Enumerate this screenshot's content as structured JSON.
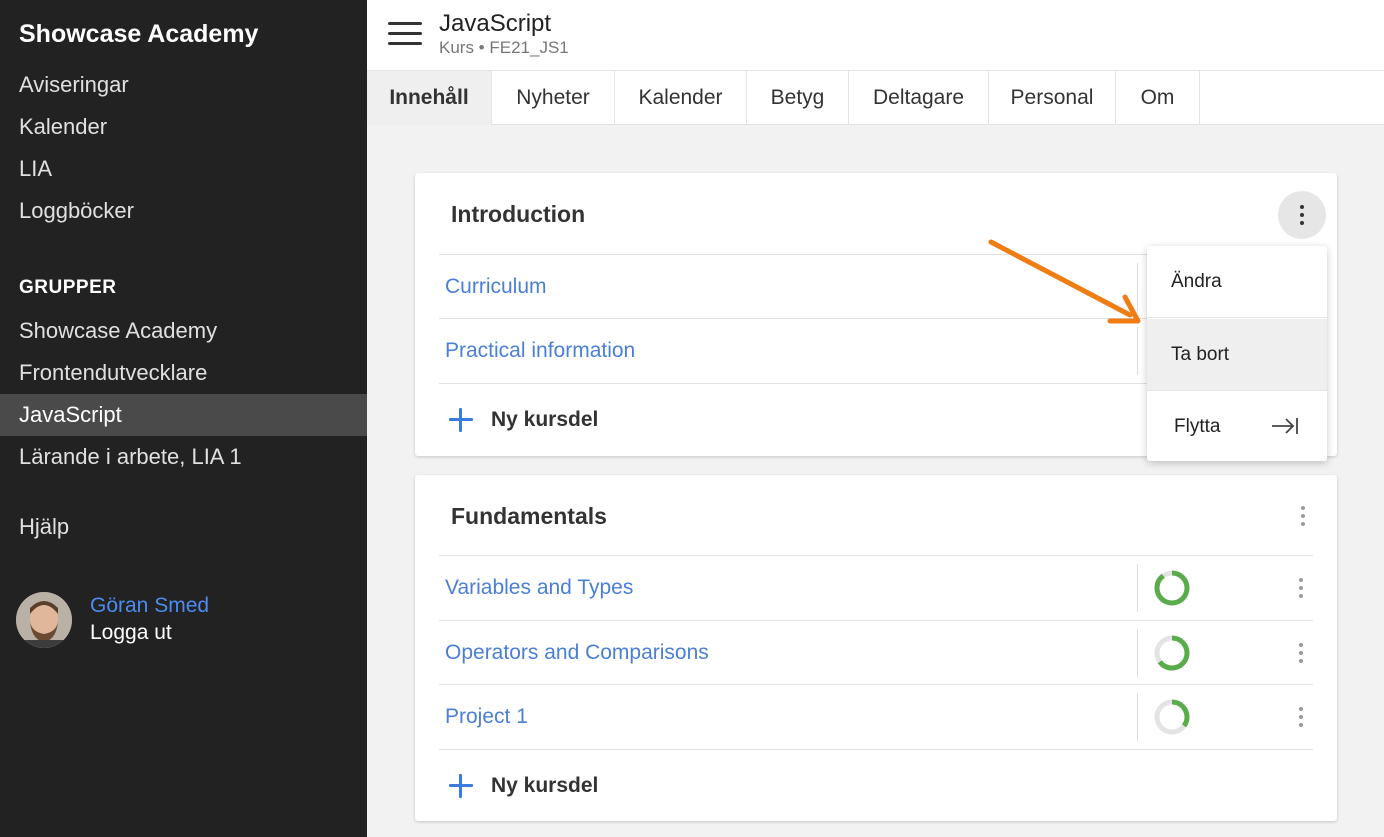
{
  "sidebar": {
    "brand": "Showcase Academy",
    "items": [
      {
        "label": "Aviseringar"
      },
      {
        "label": "Kalender"
      },
      {
        "label": "LIA"
      },
      {
        "label": "Loggböcker"
      }
    ],
    "groups_label": "GRUPPER",
    "groups": [
      {
        "label": "Showcase Academy"
      },
      {
        "label": "Frontendutvecklare"
      },
      {
        "label": "JavaScript",
        "active": true
      },
      {
        "label": "Lärande i arbete, LIA 1"
      }
    ],
    "help": "Hjälp",
    "user": {
      "name": "Göran Smed",
      "logout": "Logga ut"
    }
  },
  "header": {
    "title": "JavaScript",
    "subtitle": "Kurs • FE21_JS1"
  },
  "tabs": [
    {
      "label": "Innehåll",
      "active": true
    },
    {
      "label": "Nyheter"
    },
    {
      "label": "Kalender"
    },
    {
      "label": "Betyg"
    },
    {
      "label": "Deltagare"
    },
    {
      "label": "Personal"
    },
    {
      "label": "Om"
    }
  ],
  "sections": [
    {
      "title": "Introduction",
      "items": [
        {
          "label": "Curriculum"
        },
        {
          "label": "Practical information"
        }
      ],
      "add_label": "Ny kursdel"
    },
    {
      "title": "Fundamentals",
      "items": [
        {
          "label": "Variables and Types",
          "progress": 0.9
        },
        {
          "label": "Operators and Comparisons",
          "progress": 0.65
        },
        {
          "label": "Project 1",
          "progress": 0.35
        }
      ],
      "add_label": "Ny kursdel"
    }
  ],
  "menu": {
    "items": [
      {
        "label": "Ändra"
      },
      {
        "label": "Ta bort",
        "hovered": true
      },
      {
        "label": "Flytta",
        "icon": "move-to-end-icon"
      }
    ]
  },
  "colors": {
    "sidebar_bg": "#222222",
    "link": "#4a7fd6",
    "accent": "#3a7be0",
    "progress": "#5aac4a",
    "annotation_arrow": "#f07c14"
  }
}
